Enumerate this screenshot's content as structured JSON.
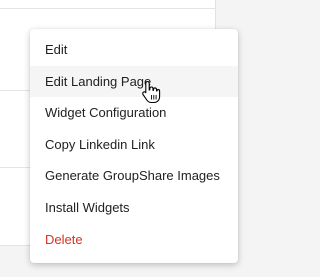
{
  "menu": {
    "items": [
      {
        "label": "Edit"
      },
      {
        "label": "Edit Landing Page"
      },
      {
        "label": "Widget Configuration"
      },
      {
        "label": "Copy Linkedin Link"
      },
      {
        "label": "Generate GroupShare Images"
      },
      {
        "label": "Install Widgets"
      },
      {
        "label": "Delete"
      }
    ],
    "hovered_item": "Edit Landing Page",
    "danger_color": "#d93025"
  },
  "cursor": {
    "icon": "hand-pointer-icon"
  }
}
